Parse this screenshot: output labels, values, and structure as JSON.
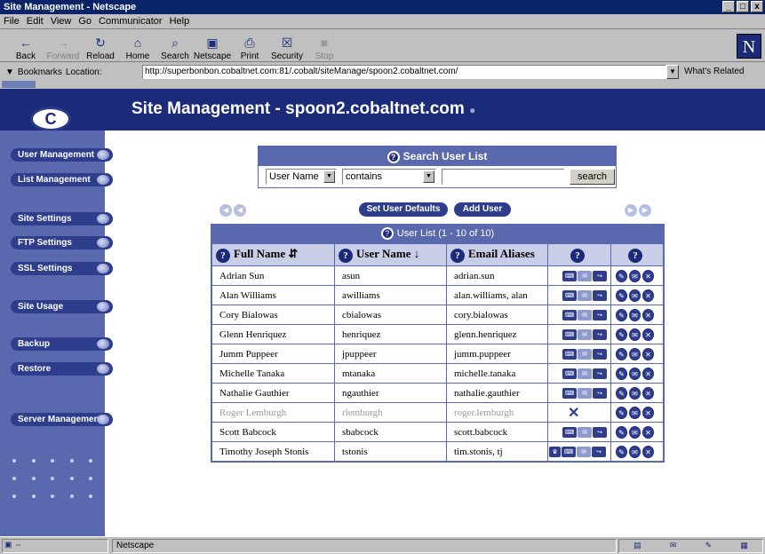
{
  "window": {
    "title": "Site Management - Netscape",
    "min_label": "_",
    "max_label": "□",
    "close_label": "x"
  },
  "menu": [
    "File",
    "Edit",
    "View",
    "Go",
    "Communicator",
    "Help"
  ],
  "toolbar": [
    {
      "label": "Back",
      "icon": "back-arrow-icon",
      "glyph": "←",
      "enabled": true
    },
    {
      "label": "Forward",
      "icon": "forward-arrow-icon",
      "glyph": "→",
      "enabled": false
    },
    {
      "label": "Reload",
      "icon": "reload-icon",
      "glyph": "↻",
      "enabled": true
    },
    {
      "label": "Home",
      "icon": "home-icon",
      "glyph": "⌂",
      "enabled": true
    },
    {
      "label": "Search",
      "icon": "search-icon",
      "glyph": "⌕",
      "enabled": true
    },
    {
      "label": "Netscape",
      "icon": "netscape-icon",
      "glyph": "▣",
      "enabled": true
    },
    {
      "label": "Print",
      "icon": "print-icon",
      "glyph": "⎙",
      "enabled": true
    },
    {
      "label": "Security",
      "icon": "security-lock-icon",
      "glyph": "☒",
      "enabled": true
    },
    {
      "label": "Stop",
      "icon": "stop-icon",
      "glyph": "■",
      "enabled": false
    }
  ],
  "logo_letter": "N",
  "location": {
    "bookmarks": "Bookmarks",
    "label": "Location:",
    "url": "http://superbonbon.cobaltnet.com:81/.cobalt/siteManage/spoon2.cobaltnet.com/",
    "related": "What's Related"
  },
  "page": {
    "title": "Site Management - spoon2.cobaltnet.com",
    "title_dot": "●",
    "logo_letter": "C"
  },
  "sidebar": [
    "User Management",
    "List Management",
    "Site Settings",
    "FTP Settings",
    "SSL Settings",
    "Site Usage",
    "Backup",
    "Restore",
    "Server Management"
  ],
  "search": {
    "title": "Search User List",
    "help": "?",
    "field": "User Name",
    "operator": "contains",
    "value": "",
    "button": "search"
  },
  "actions": {
    "set_defaults": "Set User Defaults",
    "add_user": "Add User"
  },
  "table": {
    "title": "User List (1 - 10 of 10)",
    "help": "?",
    "headers": {
      "full_name": "Full Name",
      "user_name": "User Name",
      "email_aliases": "Email Aliases"
    },
    "rows": [
      {
        "full_name": "Adrian Sun",
        "user_name": "asun",
        "email_aliases": "adrian.sun",
        "suspended": false,
        "admin": false
      },
      {
        "full_name": "Alan Williams",
        "user_name": "awilliams",
        "email_aliases": "alan.williams, alan",
        "suspended": false,
        "admin": false
      },
      {
        "full_name": "Cory Bialowas",
        "user_name": "cbialowas",
        "email_aliases": "cory.bialowas",
        "suspended": false,
        "admin": false
      },
      {
        "full_name": "Glenn Henriquez",
        "user_name": "henriquez",
        "email_aliases": "glenn.henriquez",
        "suspended": false,
        "admin": false
      },
      {
        "full_name": "Jumm Puppeer",
        "user_name": "jpuppeer",
        "email_aliases": "jumm.puppeer",
        "suspended": false,
        "admin": false
      },
      {
        "full_name": "Michelle Tanaka",
        "user_name": "mtanaka",
        "email_aliases": "michelle.tanaka",
        "suspended": false,
        "admin": false
      },
      {
        "full_name": "Nathalie Gauthier",
        "user_name": "ngauthier",
        "email_aliases": "nathalie.gauthier",
        "suspended": false,
        "admin": false
      },
      {
        "full_name": "Roger Lemburgh",
        "user_name": "rlemburgh",
        "email_aliases": "roger.lemburgh",
        "suspended": true,
        "admin": false
      },
      {
        "full_name": "Scott Babcock",
        "user_name": "sbabcock",
        "email_aliases": "scott.babcock",
        "suspended": false,
        "admin": false
      },
      {
        "full_name": "Timothy Joseph Stonis",
        "user_name": "tstonis",
        "email_aliases": "tim.stonis, tj",
        "suspended": false,
        "admin": true
      }
    ]
  },
  "status": {
    "text": "Netscape"
  },
  "colors": {
    "navy": "#1c2a7a",
    "accent": "#5a68ad",
    "header_light": "#c9cee8"
  }
}
